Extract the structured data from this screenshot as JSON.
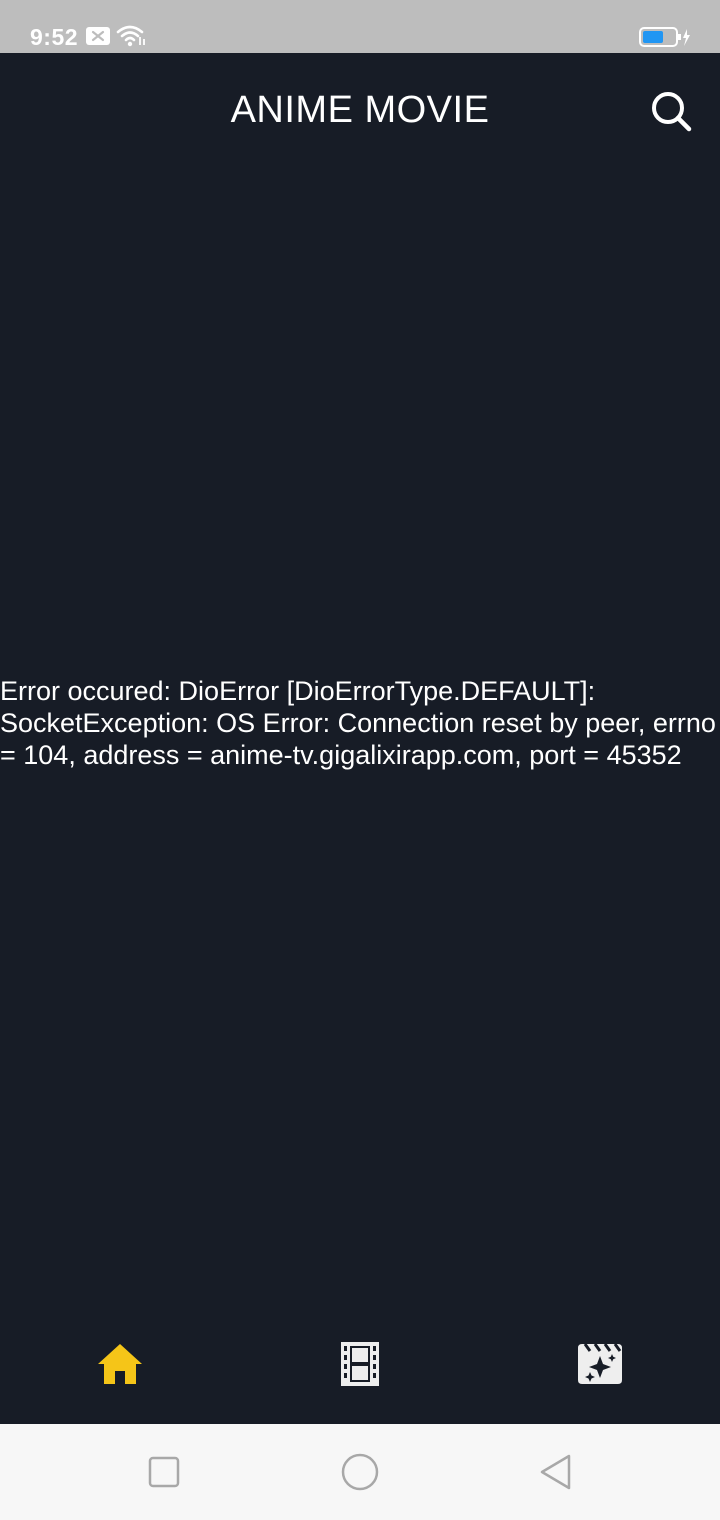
{
  "status_bar": {
    "time": "9:52",
    "icons": [
      "message-icon",
      "wifi-icon",
      "battery-charging-icon"
    ],
    "battery_color": "#2196f3"
  },
  "app_bar": {
    "title": "ANIME MOVIE",
    "search_icon": "search-icon"
  },
  "content": {
    "error_message": "Error occured: DioError [DioErrorType.DEFAULT]: SocketException: OS Error: Connection reset by peer, errno = 104, address = anime-tv.gigalixirapp.com, port = 45352"
  },
  "bottom_nav": {
    "items": [
      {
        "icon": "home-icon",
        "active": true
      },
      {
        "icon": "movie-film-icon",
        "active": false
      },
      {
        "icon": "movie-filter-icon",
        "active": false
      }
    ],
    "active_color": "#f5c518",
    "inactive_color": "#eeeeee"
  },
  "system_nav": {
    "buttons": [
      "recents-button",
      "home-button",
      "back-button"
    ]
  },
  "colors": {
    "background": "#171c26",
    "text": "#ffffff"
  }
}
